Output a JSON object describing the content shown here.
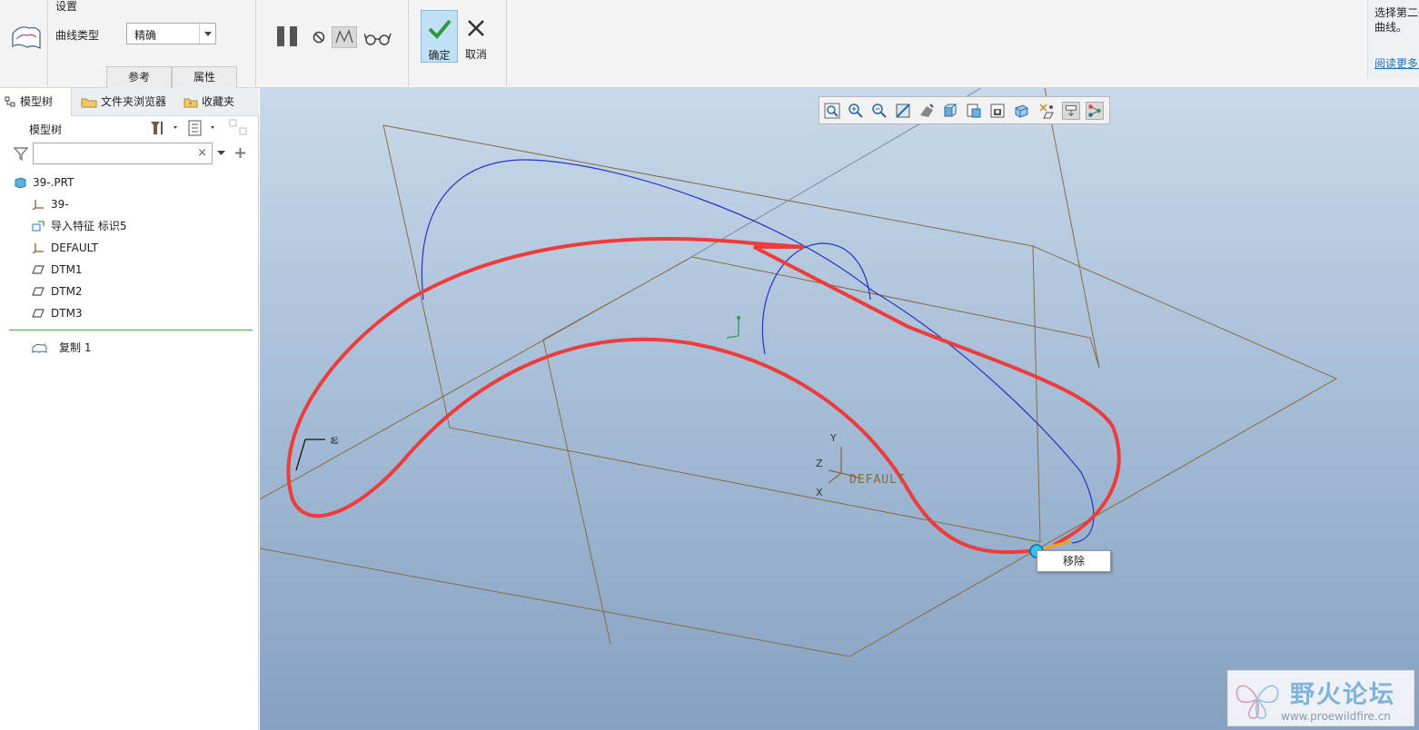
{
  "ribbon": {
    "group_title": "设置",
    "curve_type_label": "曲线类型",
    "curve_type_value": "精确",
    "subtabs": [
      "参考",
      "属性"
    ],
    "ok_label": "确定",
    "cancel_label": "取消",
    "help_text_1": "选择第二条",
    "help_text_2": "曲线。",
    "help_link": "阅读更多..."
  },
  "left_panel": {
    "tabs": [
      "模型树",
      "文件夹浏览器",
      "收藏夹"
    ],
    "tree_title": "模型树",
    "filter_placeholder": "",
    "items": [
      {
        "label": "39-.PRT",
        "icon": "part-icon"
      },
      {
        "label": "39-",
        "icon": "csys-icon"
      },
      {
        "label": "导入特征 标识5",
        "icon": "import-feature-icon"
      },
      {
        "label": "DEFAULT",
        "icon": "csys-icon"
      },
      {
        "label": "DTM1",
        "icon": "datum-plane-icon"
      },
      {
        "label": "DTM2",
        "icon": "datum-plane-icon"
      },
      {
        "label": "DTM3",
        "icon": "datum-plane-icon"
      }
    ],
    "new_feature": "复制 1"
  },
  "viewport": {
    "popup_label": "移除",
    "csys_label": "DEFAULT",
    "axis_labels": [
      "Y",
      "Z",
      "X"
    ],
    "curve_color": "#ee3b3b",
    "blue_curve_color": "#2533c4",
    "plane_color": "#8a6a40"
  },
  "watermark": {
    "title": "野火论坛",
    "url": "www.proewildfire.cn"
  }
}
